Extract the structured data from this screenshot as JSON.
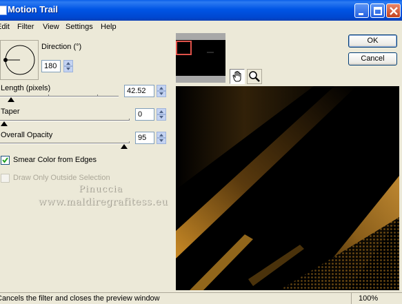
{
  "window": {
    "title": "Motion Trail",
    "controls": {
      "minimize": "minimize-icon",
      "maximize": "maximize-icon",
      "close": "close-icon"
    }
  },
  "menu": {
    "items": [
      "Edit",
      "Filter",
      "View",
      "Settings",
      "Help"
    ]
  },
  "direction": {
    "label": "Direction (°)",
    "value": "180"
  },
  "length": {
    "label": "Length (pixels)",
    "value": "42.52"
  },
  "taper": {
    "label": "Taper",
    "value": "0"
  },
  "opacity": {
    "label": "Overall Opacity",
    "value": "95"
  },
  "options": {
    "smear": {
      "label": "Smear Color from Edges",
      "checked": true
    },
    "draw_outside": {
      "label": "Draw Only Outside Selection",
      "checked": false,
      "enabled": false
    }
  },
  "watermark": {
    "line1": "Pinuccia",
    "line2": "www.maldiregrafitess.eu"
  },
  "buttons": {
    "ok": "OK",
    "cancel": "Cancel"
  },
  "tools": {
    "pan": "hand-icon",
    "zoom": "magnifier-icon"
  },
  "status": {
    "message": "Cancels the filter and closes the preview window",
    "zoom": "100%"
  },
  "colors": {
    "titlebar": "#0055e5",
    "preview_accent": "#c98a26",
    "nav_rect": "#e0524a"
  }
}
